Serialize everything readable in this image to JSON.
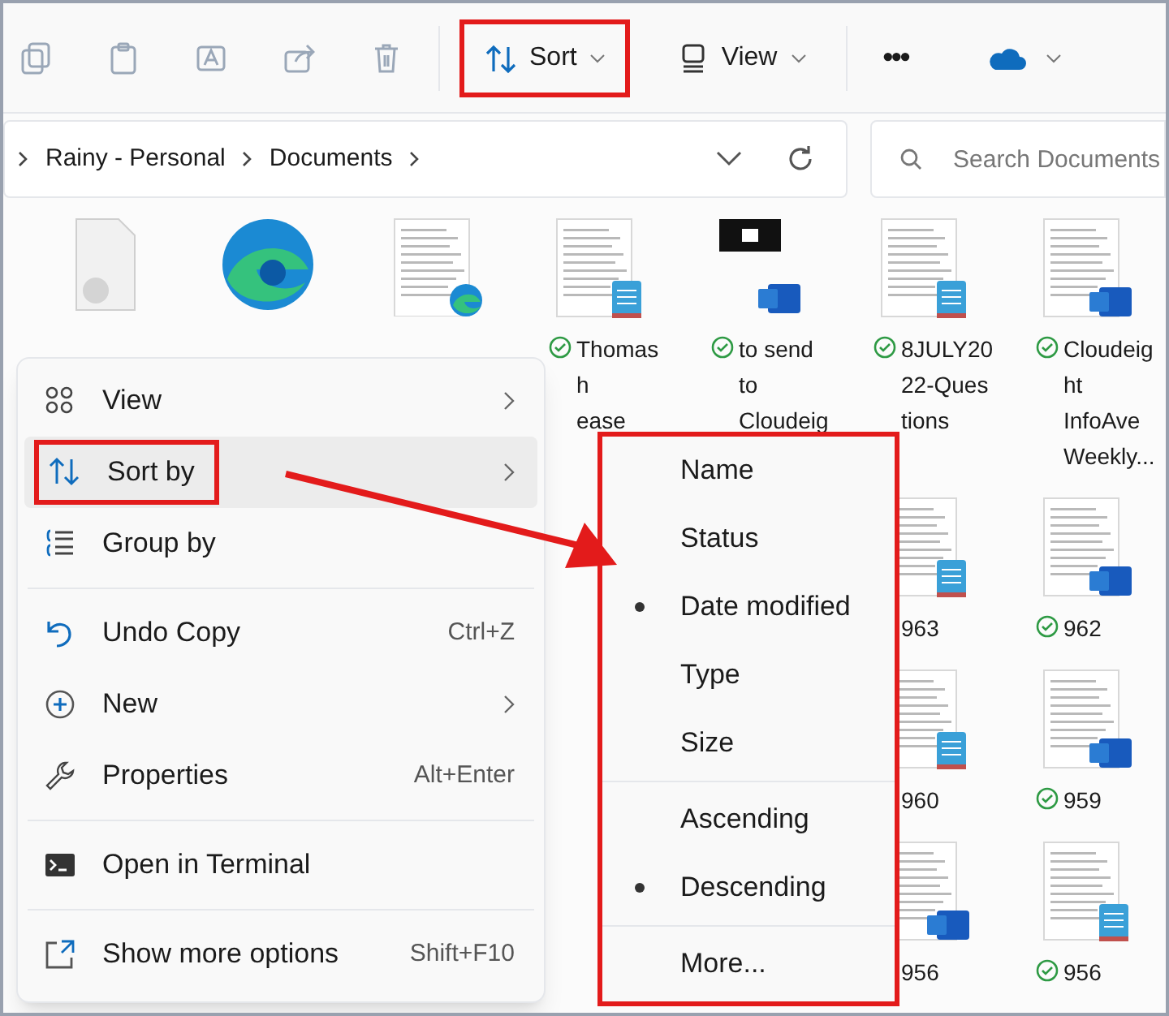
{
  "toolbar": {
    "icons": [
      {
        "kind": "copy"
      },
      {
        "kind": "paste"
      },
      {
        "kind": "rename"
      },
      {
        "kind": "share"
      },
      {
        "kind": "delete"
      }
    ],
    "sort_button": {
      "label": "Sort",
      "highlighted": true
    },
    "view_button": {
      "label": "View"
    },
    "more_button": {
      "label": "•••"
    }
  },
  "address_bar": {
    "path": [
      "Rainy - Personal",
      "Documents"
    ]
  },
  "search": {
    "placeholder": "Search Documents"
  },
  "files": [
    {
      "kind": "generic"
    },
    {
      "kind": "edge"
    },
    {
      "kind": "doc-edge"
    },
    {
      "kind": "doc-notepad",
      "label": [
        "Thomas",
        "h",
        "ease"
      ],
      "synced": true
    },
    {
      "kind": "black-word",
      "label": [
        "to send",
        "to",
        "Cloudeig"
      ],
      "synced": true
    },
    {
      "kind": "doc-notepad",
      "label": [
        "8JULY20",
        "22-Ques",
        "tions"
      ],
      "synced": true
    },
    {
      "kind": "doc-word",
      "label": [
        "Cloudeig",
        "ht",
        "InfoAve",
        "Weekly..."
      ],
      "synced": true
    },
    {
      "kind": "doc-notepad",
      "label": [
        "963"
      ]
    },
    {
      "kind": "doc-word",
      "label": [
        "962"
      ],
      "synced": true
    },
    {
      "kind": "doc-notepad",
      "label": [
        "960"
      ]
    },
    {
      "kind": "doc-word",
      "label": [
        "959"
      ],
      "synced": true
    },
    {
      "kind": "doc-word",
      "label": [
        "956"
      ]
    },
    {
      "kind": "doc-notepad",
      "label": [
        "956"
      ],
      "synced": true
    }
  ],
  "context_menu": {
    "items": [
      {
        "kind": "view",
        "label": "View",
        "submenu": true,
        "highlighted": false
      },
      {
        "kind": "sort",
        "label": "Sort by",
        "submenu": true,
        "highlighted": true
      },
      {
        "kind": "group",
        "label": "Group by",
        "highlighted": false
      },
      {
        "kind": "divider"
      },
      {
        "kind": "undo",
        "label": "Undo Copy",
        "shortcut": "Ctrl+Z",
        "highlighted": false
      },
      {
        "kind": "new",
        "label": "New",
        "submenu": true,
        "highlighted": false
      },
      {
        "kind": "properties",
        "label": "Properties",
        "shortcut": "Alt+Enter",
        "highlighted": false
      },
      {
        "kind": "divider"
      },
      {
        "kind": "terminal",
        "label": "Open in Terminal",
        "highlighted": false
      },
      {
        "kind": "divider"
      },
      {
        "kind": "more",
        "label": "Show more options",
        "shortcut": "Shift+F10",
        "highlighted": false
      }
    ]
  },
  "sort_submenu": {
    "highlighted": true,
    "items": [
      {
        "kind": "option",
        "label": "Name",
        "selected": false
      },
      {
        "kind": "option",
        "label": "Status",
        "selected": false
      },
      {
        "kind": "option",
        "label": "Date modified",
        "selected": true
      },
      {
        "kind": "option",
        "label": "Type",
        "selected": false
      },
      {
        "kind": "option",
        "label": "Size",
        "selected": false
      },
      {
        "kind": "divider"
      },
      {
        "kind": "option",
        "label": "Ascending",
        "selected": false
      },
      {
        "kind": "option",
        "label": "Descending",
        "selected": true
      },
      {
        "kind": "divider"
      },
      {
        "kind": "option",
        "label": "More...",
        "selected": false
      }
    ]
  }
}
